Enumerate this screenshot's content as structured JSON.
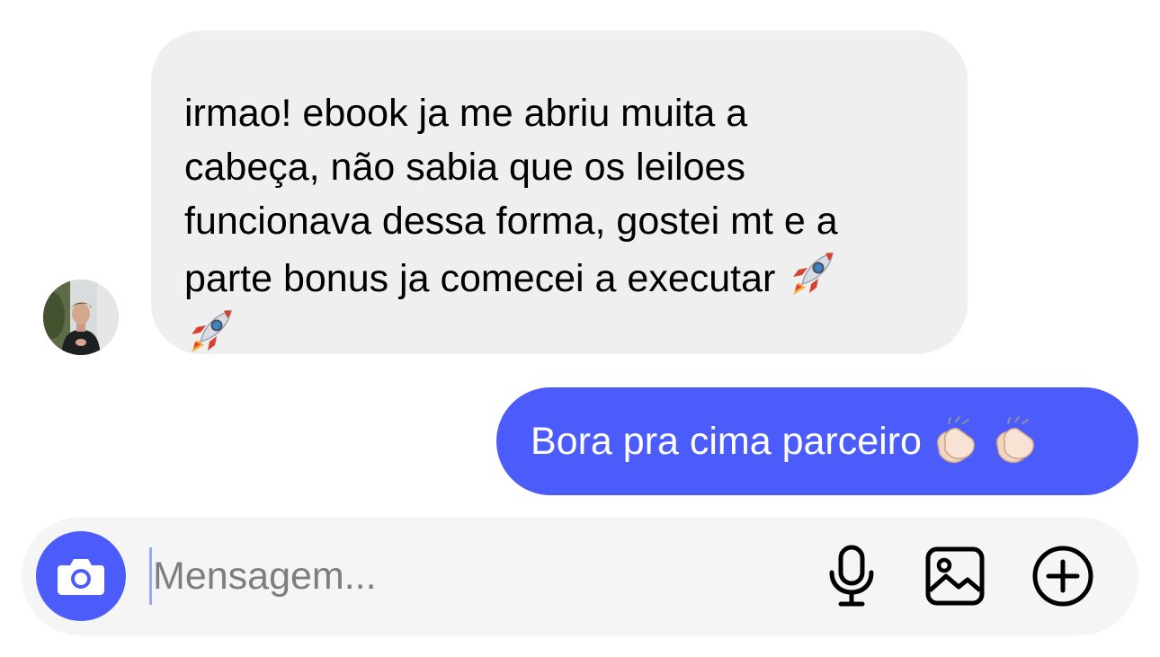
{
  "conversation": {
    "incoming": {
      "text": "irmao! ebook ja me abriu muita a\ncabeça, não sabia que os leiloes\nfuncionava dessa forma, gostei mt e a\nparte bonus ja comecei a executar ",
      "emoji_icons": [
        "rocket-emoji",
        "rocket-emoji"
      ],
      "avatar_icon": "avatar"
    },
    "outgoing": {
      "text": "Bora pra cima parceiro",
      "emoji_icons": [
        "clapping-hands-emoji",
        "clapping-hands-emoji"
      ]
    }
  },
  "composer": {
    "placeholder": "Mensagem...",
    "value": "",
    "icons": {
      "camera": "camera-icon",
      "mic": "microphone-icon",
      "gallery": "gallery-icon",
      "plus": "plus-circle-icon"
    }
  },
  "colors": {
    "accent": "#4c5cfb",
    "incoming_bubble": "#efefef",
    "composer_bg": "#f5f5f5",
    "placeholder": "#7e7e7e"
  }
}
